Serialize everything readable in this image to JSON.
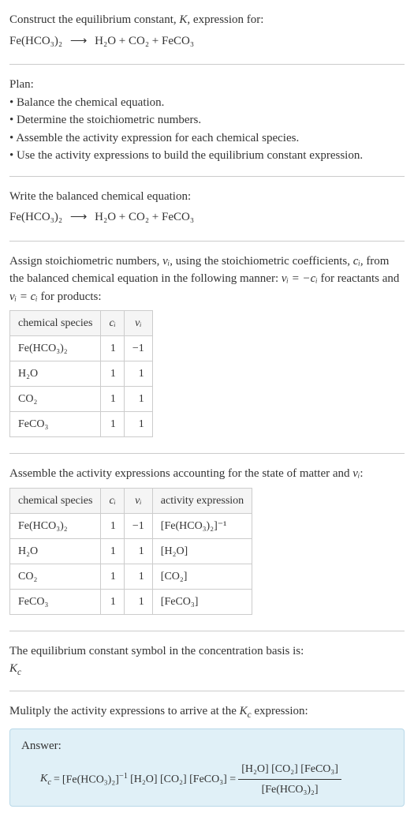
{
  "intro": {
    "line1_pre": "Construct the equilibrium constant, ",
    "line1_K": "K",
    "line1_post": ", expression for:",
    "eq_lhs": "Fe(HCO₃)₂",
    "eq_arrow": "⟶",
    "eq_rhs": "H₂O + CO₂ + FeCO₃"
  },
  "plan": {
    "title": "Plan:",
    "items": [
      "Balance the chemical equation.",
      "Determine the stoichiometric numbers.",
      "Assemble the activity expression for each chemical species.",
      "Use the activity expressions to build the equilibrium constant expression."
    ]
  },
  "balanced": {
    "title": "Write the balanced chemical equation:",
    "eq_lhs": "Fe(HCO₃)₂",
    "eq_arrow": "⟶",
    "eq_rhs": "H₂O + CO₂ + FeCO₃"
  },
  "stoich": {
    "text_pre": "Assign stoichiometric numbers, ",
    "nu_i": "νᵢ",
    "text_mid1": ", using the stoichiometric coefficients, ",
    "c_i": "cᵢ",
    "text_mid2": ", from the balanced chemical equation in the following manner: ",
    "rel1": "νᵢ = −cᵢ",
    "text_mid3": " for reactants and ",
    "rel2": "νᵢ = cᵢ",
    "text_post": " for products:",
    "headers": [
      "chemical species",
      "cᵢ",
      "νᵢ"
    ],
    "rows": [
      {
        "species": "Fe(HCO₃)₂",
        "c": "1",
        "nu": "−1"
      },
      {
        "species": "H₂O",
        "c": "1",
        "nu": "1"
      },
      {
        "species": "CO₂",
        "c": "1",
        "nu": "1"
      },
      {
        "species": "FeCO₃",
        "c": "1",
        "nu": "1"
      }
    ]
  },
  "activity": {
    "text_pre": "Assemble the activity expressions accounting for the state of matter and ",
    "nu_i": "νᵢ",
    "text_post": ":",
    "headers": [
      "chemical species",
      "cᵢ",
      "νᵢ",
      "activity expression"
    ],
    "rows": [
      {
        "species": "Fe(HCO₃)₂",
        "c": "1",
        "nu": "−1",
        "expr": "[Fe(HCO₃)₂]⁻¹"
      },
      {
        "species": "H₂O",
        "c": "1",
        "nu": "1",
        "expr": "[H₂O]"
      },
      {
        "species": "CO₂",
        "c": "1",
        "nu": "1",
        "expr": "[CO₂]"
      },
      {
        "species": "FeCO₃",
        "c": "1",
        "nu": "1",
        "expr": "[FeCO₃]"
      }
    ]
  },
  "symbol": {
    "text": "The equilibrium constant symbol in the concentration basis is:",
    "kc": "K",
    "kc_sub": "c"
  },
  "multiply": {
    "text_pre": "Mulitply the activity expressions to arrive at the ",
    "kc": "K",
    "kc_sub": "c",
    "text_post": " expression:"
  },
  "answer": {
    "label": "Answer:",
    "kc": "K",
    "kc_sub": "c",
    "eq": " = ",
    "term1": "[Fe(HCO₃)₂]",
    "exp1": "−1",
    "term2": " [H₂O] [CO₂] [FeCO₃] = ",
    "frac_num": "[H₂O] [CO₂] [FeCO₃]",
    "frac_den": "[Fe(HCO₃)₂]"
  }
}
